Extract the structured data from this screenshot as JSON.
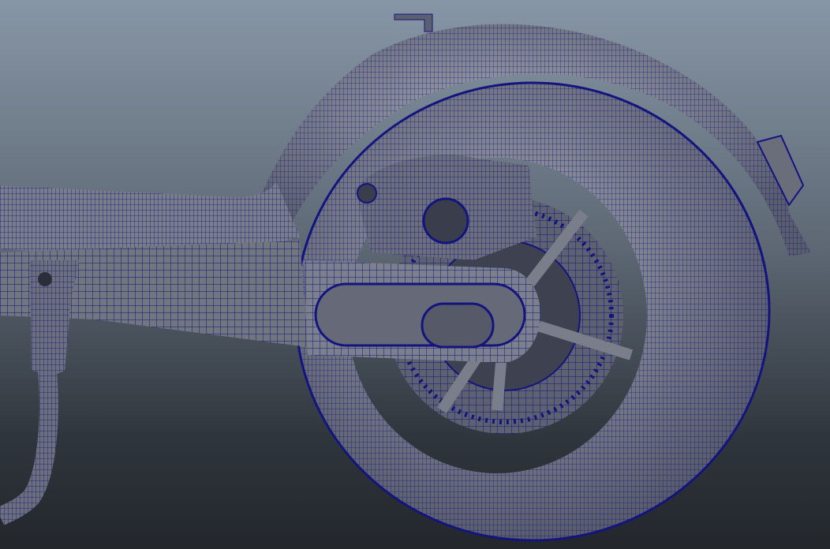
{
  "viewport": {
    "kind": "3d-wireframe-on-shaded",
    "colors": {
      "background_top": "#8796a6",
      "background_bottom": "#23272c",
      "surface": "#7c808c",
      "wire": "#12127a"
    }
  }
}
